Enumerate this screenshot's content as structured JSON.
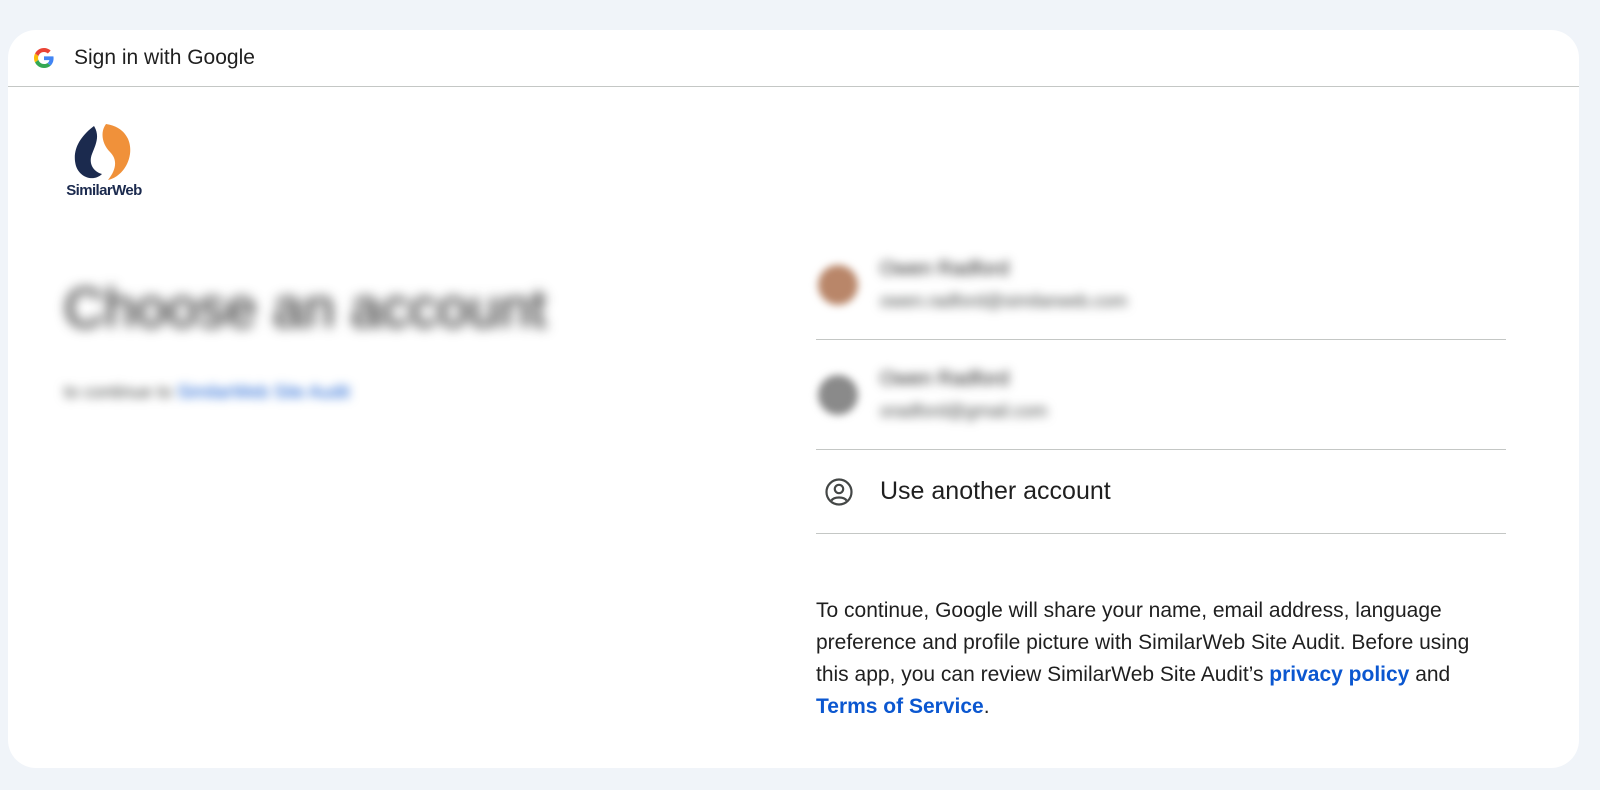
{
  "header": {
    "title": "Sign in with Google",
    "icon": "google-g-icon"
  },
  "brand": {
    "logo_text": "SimilarWeb",
    "colors": {
      "navy": "#1b2a4e",
      "orange": "#f0913a"
    }
  },
  "main": {
    "title": "Choose an account",
    "subtitle_prefix": "to continue to ",
    "subtitle_app": "SimilarWeb Site Audit"
  },
  "accounts": [
    {
      "name": "Owen Radford",
      "email": "owen.radford@similarweb.com"
    },
    {
      "name": "Owen Radford",
      "email": "oradford@gmail.com"
    }
  ],
  "use_another": {
    "label": "Use another account",
    "icon": "person-circle-icon"
  },
  "disclaimer": {
    "text": "To continue, Google will share your name, email address, language preference and profile picture with SimilarWeb Site Audit. Before using this app, you can review SimilarWeb Site Audit’s ",
    "privacy_label": "privacy policy",
    "and": " and ",
    "terms_label": "Terms of Service",
    "end": "."
  },
  "colors": {
    "background": "#f0f4f9",
    "link": "#0b57d0",
    "divider": "#c4c7c5"
  }
}
